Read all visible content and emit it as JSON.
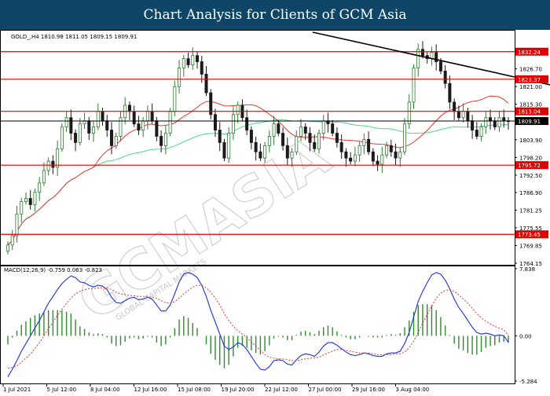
{
  "header": {
    "title": "Chart Analysis for Clients of GCM Asia"
  },
  "watermark": {
    "text": "GCMASIA",
    "subtext": "GLOBAL CAPITAL MARKETS"
  },
  "colors": {
    "banner": "#0f4566",
    "bull": "#2e7d32",
    "bear": "#1b1b1b",
    "ma_fast": "#e53935",
    "ma_slow": "#4cd98a",
    "level": "#e00000",
    "trend": "#000000",
    "macd": "#1f2fe0",
    "signal": "#e53935",
    "hist": "#2e8b2e"
  },
  "chart_data": [
    {
      "type": "line",
      "subtype": "candlestick",
      "info": "GOLD_,H4  1810.98 1811.05 1809.15 1809.91",
      "ylim": [
        1764.15,
        1838.5
      ],
      "y_ticks": [
        "1832.24",
        "1826.70",
        "1823.37",
        "1821.00",
        "1815.30",
        "1813.04",
        "1809.91",
        "1803.90",
        "1798.20",
        "1795.72",
        "1792.50",
        "1786.90",
        "1781.25",
        "1775.55",
        "1773.45",
        "1769.85",
        "1764.15"
      ],
      "highlighted_levels": [
        {
          "label": "1832.24",
          "value": 1832.24,
          "color": "#e00000"
        },
        {
          "label": "1823.37",
          "value": 1823.37,
          "color": "#e00000"
        },
        {
          "label": "1813.04",
          "value": 1813.04,
          "color": "#e00000"
        },
        {
          "label": "1795.72",
          "value": 1795.72,
          "color": "#e00000"
        },
        {
          "label": "1773.45",
          "value": 1773.45,
          "color": "#e00000"
        },
        {
          "label": "1809.91",
          "value": 1809.91,
          "color": "#000000"
        }
      ],
      "support_resistance": [
        1832.24,
        1823.37,
        1813.04,
        1795.72,
        1773.45
      ],
      "current_price": 1809.91,
      "trendline": [
        {
          "bar": 65,
          "price": 1838.5
        },
        {
          "bar": 160,
          "price": 1809.0
        }
      ],
      "closes": [
        1770,
        1773,
        1780,
        1784,
        1785,
        1783,
        1787,
        1790,
        1794,
        1797,
        1795,
        1801,
        1808,
        1811,
        1806,
        1803,
        1809,
        1810,
        1806,
        1808,
        1813,
        1810,
        1807,
        1802,
        1805,
        1811,
        1815,
        1813,
        1809,
        1807,
        1810,
        1813,
        1810,
        1805,
        1802,
        1806,
        1813,
        1821,
        1827,
        1830,
        1828,
        1831,
        1829,
        1825,
        1819,
        1812,
        1807,
        1803,
        1798,
        1806,
        1812,
        1815,
        1811,
        1807,
        1803,
        1800,
        1798,
        1802,
        1805,
        1809,
        1806,
        1802,
        1798,
        1800,
        1805,
        1808,
        1806,
        1803,
        1801,
        1806,
        1810,
        1809,
        1806,
        1803,
        1800,
        1798,
        1797,
        1799,
        1802,
        1804,
        1800,
        1797,
        1796,
        1799,
        1802,
        1800,
        1798,
        1800,
        1809,
        1816,
        1827,
        1833,
        1831,
        1830,
        1832,
        1829,
        1826,
        1822,
        1816,
        1813,
        1811,
        1813,
        1810,
        1807,
        1805,
        1808,
        1811,
        1810,
        1808,
        1811,
        1810,
        1809.91
      ],
      "ma_fast": {
        "name": "",
        "period_bars": 20
      },
      "ma_slow": {
        "name": "",
        "period_bars": 50
      },
      "x_ticks": [
        "1 Jul 2021",
        "5 Jul 12:00",
        "8 Jul 04:00",
        "12 Jul 16:00",
        "15 Jul 08:00",
        "19 Jul 20:00",
        "22 Jul 12:00",
        "27 Jul 00:00",
        "29 Jul 16:00",
        "3 Aug 04:00"
      ]
    },
    {
      "type": "line",
      "subtype": "macd",
      "label": "MACD(12,26,9) -0.759 0.063 -0.823",
      "ylim": [
        -5.284,
        7.838
      ],
      "y_ticks": [
        "7.838",
        "0.00",
        "-5.284"
      ],
      "series": [
        {
          "name": "",
          "values": [
            -4.8,
            -3.9,
            -2.9,
            -1.8,
            -0.9,
            0.0,
            0.9,
            1.8,
            2.8,
            3.8,
            4.6,
            5.4,
            6.1,
            6.6,
            7.0,
            6.8,
            6.3,
            6.2,
            5.9,
            5.7,
            5.9,
            5.8,
            5.4,
            4.5,
            3.9,
            3.8,
            4.1,
            4.4,
            4.5,
            4.2,
            4.3,
            4.5,
            4.3,
            3.6,
            2.9,
            2.9,
            3.6,
            4.9,
            6.3,
            7.2,
            7.4,
            7.2,
            6.8,
            5.9,
            4.6,
            3.0,
            1.6,
            0.2,
            -1.2,
            -1.6,
            -1.3,
            -0.8,
            -1.0,
            -1.6,
            -2.4,
            -3.2,
            -3.9,
            -4.0,
            -3.6,
            -2.9,
            -2.8,
            -2.9,
            -3.3,
            -3.4,
            -2.8,
            -2.3,
            -2.1,
            -2.2,
            -2.4,
            -1.9,
            -1.2,
            -0.8,
            -0.8,
            -1.1,
            -1.5,
            -1.9,
            -2.2,
            -2.3,
            -2.2,
            -2.0,
            -2.1,
            -2.3,
            -2.4,
            -2.4,
            -2.1,
            -2.0,
            -2.0,
            -1.8,
            -0.9,
            0.4,
            2.2,
            4.0,
            5.2,
            6.2,
            7.1,
            7.4,
            7.2,
            6.5,
            5.5,
            4.3,
            3.3,
            2.6,
            1.8,
            1.0,
            0.4,
            0.2,
            0.3,
            0.2,
            0.0,
            0.1,
            0.0,
            -0.76
          ]
        },
        {
          "name": "",
          "values": [
            -3.8,
            -3.7,
            -3.5,
            -3.1,
            -2.6,
            -2.1,
            -1.5,
            -0.8,
            0.0,
            0.8,
            1.6,
            2.4,
            3.1,
            3.8,
            4.4,
            4.9,
            5.2,
            5.4,
            5.5,
            5.5,
            5.6,
            5.6,
            5.6,
            5.4,
            5.1,
            4.9,
            4.8,
            4.7,
            4.7,
            4.6,
            4.6,
            4.6,
            4.5,
            4.4,
            4.1,
            3.9,
            3.8,
            4.0,
            4.4,
            4.9,
            5.3,
            5.7,
            5.9,
            5.9,
            5.6,
            5.1,
            4.4,
            3.6,
            2.6,
            1.8,
            1.1,
            0.6,
            0.2,
            -0.2,
            -0.7,
            -1.2,
            -1.7,
            -2.2,
            -2.5,
            -2.6,
            -2.7,
            -2.7,
            -2.8,
            -2.9,
            -2.9,
            -2.8,
            -2.7,
            -2.6,
            -2.6,
            -2.5,
            -2.2,
            -2.0,
            -1.8,
            -1.6,
            -1.6,
            -1.7,
            -1.8,
            -1.9,
            -2.0,
            -2.0,
            -2.0,
            -2.1,
            -2.2,
            -2.2,
            -2.2,
            -2.2,
            -2.1,
            -2.1,
            -1.9,
            -1.4,
            -0.6,
            0.4,
            1.5,
            2.5,
            3.5,
            4.4,
            5.0,
            5.3,
            5.4,
            5.2,
            4.8,
            4.3,
            3.8,
            3.2,
            2.6,
            2.1,
            1.7,
            1.4,
            1.1,
            0.9,
            0.7,
            0.06
          ]
        }
      ],
      "histogram_last": -0.823
    }
  ]
}
